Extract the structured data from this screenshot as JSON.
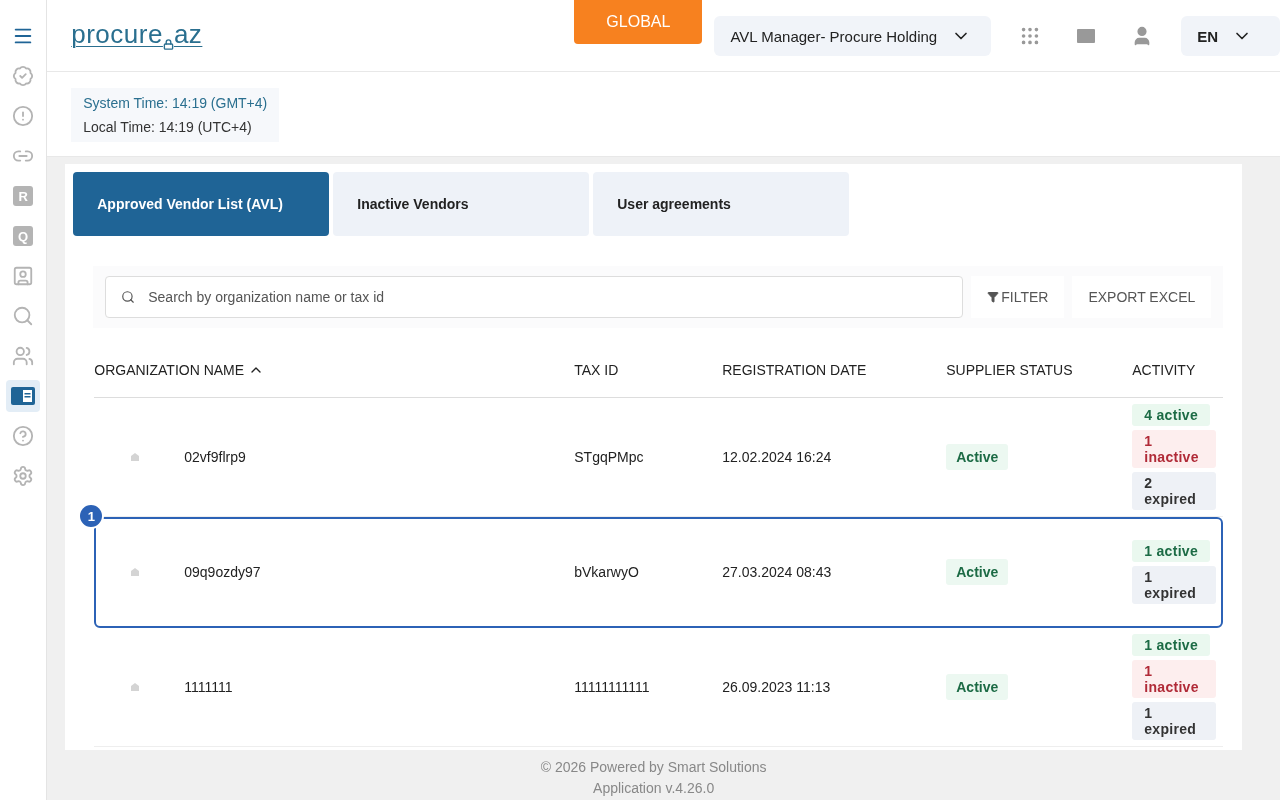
{
  "sidebar": {
    "items": [
      {
        "kind": "badge",
        "selected": false
      },
      {
        "kind": "alert",
        "selected": false
      },
      {
        "kind": "link",
        "selected": false
      },
      {
        "kind": "r",
        "label": "R",
        "selected": false
      },
      {
        "kind": "q",
        "label": "Q",
        "selected": false
      },
      {
        "kind": "contact",
        "selected": false
      },
      {
        "kind": "search",
        "selected": false
      },
      {
        "kind": "users",
        "selected": false
      },
      {
        "kind": "list",
        "selected": true
      },
      {
        "kind": "help",
        "selected": false
      },
      {
        "kind": "settings",
        "selected": false
      }
    ]
  },
  "header": {
    "logo": {
      "left": "procure",
      "right": "az"
    },
    "global_button": "GLOBAL",
    "role_select": "AVL Manager- Procure Holding",
    "language": "EN"
  },
  "times": {
    "system": "System Time: 14:19 (GMT+4)",
    "local": "Local Time: 14:19 (UTC+4)"
  },
  "tabs": [
    {
      "label": "Approved Vendor List (AVL)",
      "selected": true
    },
    {
      "label": "Inactive Vendors",
      "selected": false
    },
    {
      "label": "User agreements",
      "selected": false
    }
  ],
  "search": {
    "placeholder": "Search by organization name or tax id"
  },
  "actions": {
    "filter": "FILTER",
    "export": "EXPORT EXCEL"
  },
  "table": {
    "columns": [
      {
        "label": "ORGANIZATION NAME",
        "sorted": true
      },
      {
        "label": "TAX ID",
        "sorted": false
      },
      {
        "label": "REGISTRATION DATE",
        "sorted": false
      },
      {
        "label": "SUPPLIER STATUS",
        "sorted": false
      },
      {
        "label": "ACTIVITY",
        "sorted": false
      }
    ],
    "rows": [
      {
        "name": "02vf9flrp9",
        "tax_id": "STgqPMpc",
        "registration_date": "12.02.2024 16:24",
        "status": "Active",
        "activity": [
          {
            "kind": "active",
            "text": "4 active"
          },
          {
            "kind": "inactive",
            "text": "1 inactive"
          },
          {
            "kind": "expired",
            "text": "2 expired"
          }
        ],
        "highlighted": false
      },
      {
        "name": "09q9ozdy97",
        "tax_id": "bVkarwyO",
        "registration_date": "27.03.2024 08:43",
        "status": "Active",
        "activity": [
          {
            "kind": "active",
            "text": "1 active"
          },
          {
            "kind": "expired",
            "text": "1 expired"
          }
        ],
        "highlighted": true,
        "marker": "1"
      },
      {
        "name": "1111111",
        "tax_id": "11111111111",
        "registration_date": "26.09.2023 11:13",
        "status": "Active",
        "activity": [
          {
            "kind": "active",
            "text": "1 active"
          },
          {
            "kind": "inactive",
            "text": "1 inactive"
          },
          {
            "kind": "expired",
            "text": "1 expired"
          }
        ],
        "highlighted": false
      }
    ]
  },
  "footer": {
    "copyright": "© 2026 Powered by Smart Solutions",
    "version": "Application v.4.26.0"
  }
}
